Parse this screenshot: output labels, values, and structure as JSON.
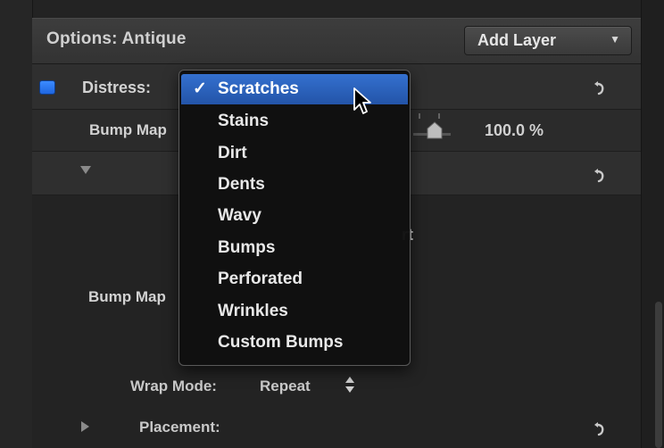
{
  "header": {
    "title": "Options: Antique",
    "add_layer_label": "Add Layer"
  },
  "rows": {
    "distress_label": "Distress:",
    "bump_map_amount_label": "Bump Map",
    "bump_map_amount_value": "100.0 %",
    "bump_map_label": "Bump Map",
    "partial_text": "rt",
    "wrap_mode_label": "Wrap Mode:",
    "wrap_mode_value": "Repeat",
    "placement_label": "Placement:"
  },
  "distress_menu": {
    "selected": "Scratches",
    "check_glyph": "✓",
    "items": [
      "Scratches",
      "Stains",
      "Dirt",
      "Dents",
      "Wavy",
      "Bumps",
      "Perforated",
      "Wrinkles",
      "Custom Bumps"
    ]
  },
  "icons": {
    "reset": "reset-arrow-icon",
    "dropdown": "chevron-down-icon",
    "stepper": "stepper-icon",
    "disclosure_open": "disclosure-down-icon",
    "disclosure_closed": "disclosure-right-icon",
    "cursor": "mouse-pointer-icon"
  },
  "colors": {
    "checkbox": "#2a75f0",
    "menu_highlight": "#2c62bc",
    "panel_bg": "#232323"
  },
  "slider": {
    "value_percent": 100
  }
}
